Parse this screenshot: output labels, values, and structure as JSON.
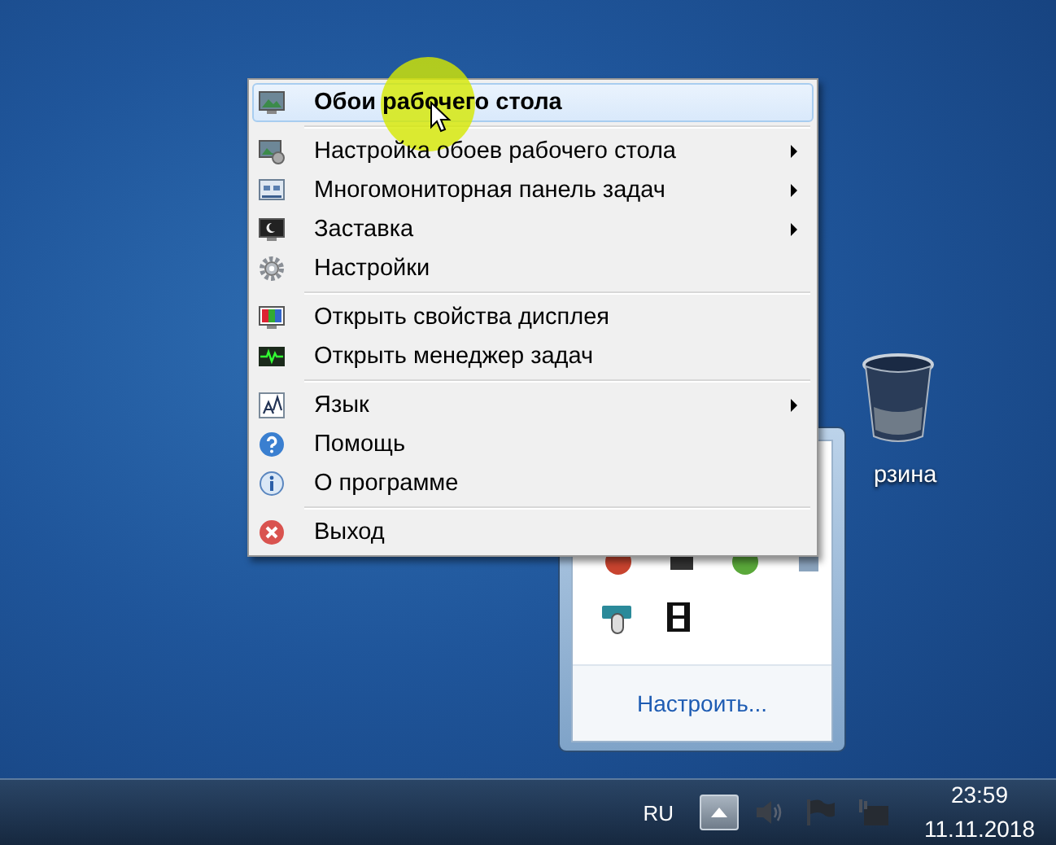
{
  "context_menu": {
    "groups": [
      [
        {
          "label": "Обои рабочего стола",
          "selected": true,
          "submenu": false
        }
      ],
      [
        {
          "label": "Настройка обоев рабочего стола",
          "selected": false,
          "submenu": true
        },
        {
          "label": "Многомониторная панель задач",
          "selected": false,
          "submenu": true
        },
        {
          "label": "Заставка",
          "selected": false,
          "submenu": true
        },
        {
          "label": "Настройки",
          "selected": false,
          "submenu": false
        }
      ],
      [
        {
          "label": "Открыть свойства дисплея",
          "selected": false,
          "submenu": false
        },
        {
          "label": "Открыть менеджер задач",
          "selected": false,
          "submenu": false
        }
      ],
      [
        {
          "label": "Язык",
          "selected": false,
          "submenu": true
        },
        {
          "label": "Помощь",
          "selected": false,
          "submenu": false
        },
        {
          "label": "О программе",
          "selected": false,
          "submenu": false
        }
      ],
      [
        {
          "label": "Выход",
          "selected": false,
          "submenu": false
        }
      ]
    ]
  },
  "desktop_icon": {
    "label": "рзина"
  },
  "tray_popup": {
    "link": "Настроить..."
  },
  "taskbar": {
    "language": "RU",
    "time": "23:59",
    "date": "11.11.2018"
  }
}
